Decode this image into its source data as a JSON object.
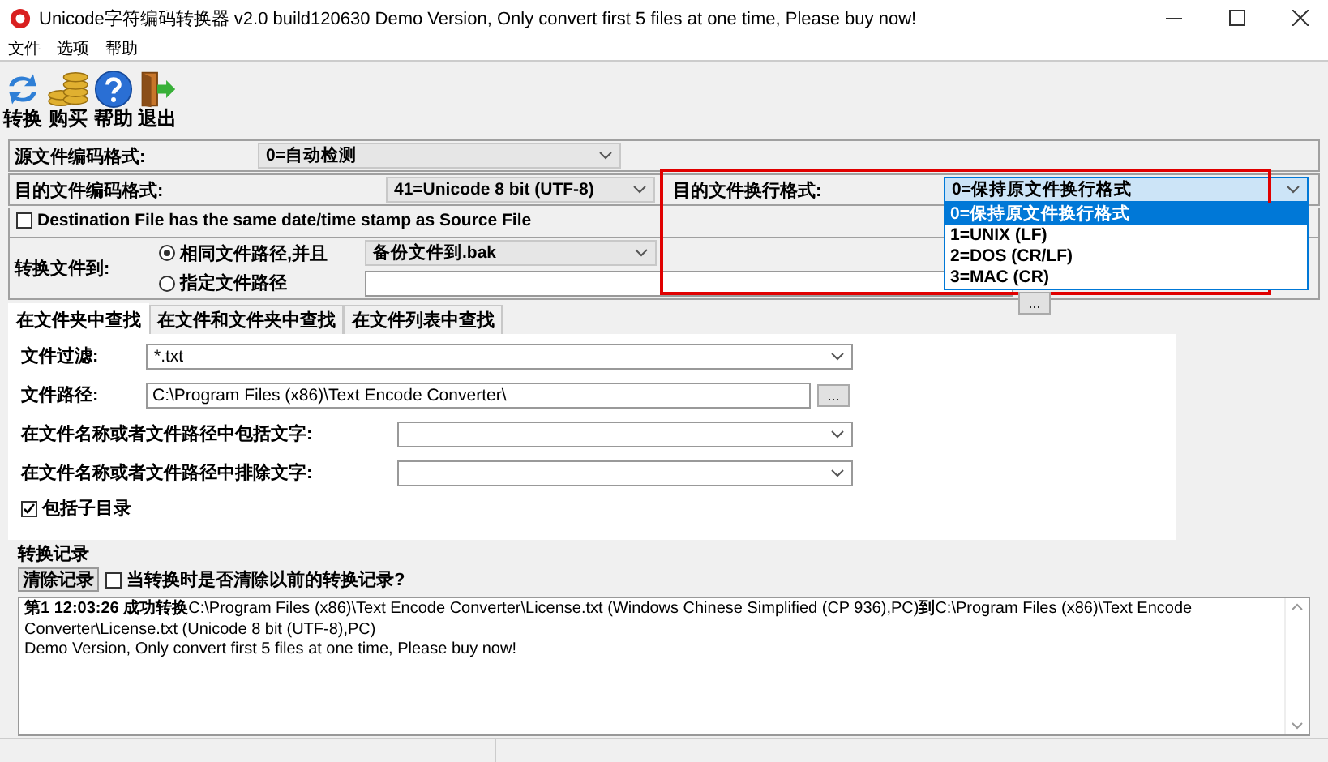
{
  "window": {
    "title": "Unicode字符编码转换器 v2.0 build120630 Demo Version, Only convert first 5 files at one time, Please buy now!"
  },
  "menu": [
    "文件",
    "选项",
    "帮助"
  ],
  "toolbar": [
    {
      "kind": "convert",
      "label": "转换"
    },
    {
      "kind": "buy",
      "label": "购买"
    },
    {
      "kind": "help",
      "label": "帮助"
    },
    {
      "kind": "exit",
      "label": "退出"
    }
  ],
  "source_encoding": {
    "label": "源文件编码格式:",
    "value": "0=自动检测"
  },
  "target_encoding": {
    "label": "目的文件编码格式:",
    "value": "41=Unicode 8 bit (UTF-8)"
  },
  "line_ending": {
    "label": "目的文件换行格式:",
    "value": "0=保持原文件换行格式",
    "expanded": true,
    "options": [
      {
        "label": "0=保持原文件换行格式",
        "selected": true
      },
      {
        "label": "1=UNIX (LF)",
        "selected": false
      },
      {
        "label": "2=DOS (CR/LF)",
        "selected": false
      },
      {
        "label": "3=MAC (CR)",
        "selected": false
      }
    ]
  },
  "same_timestamp": {
    "label": "Destination File has the same date/time stamp as Source File",
    "checked": false
  },
  "convert_to": {
    "label": "转换文件到:",
    "options": [
      {
        "label": "相同文件路径,并且",
        "selected": true
      },
      {
        "label": "指定文件路径",
        "selected": false
      }
    ],
    "backup": "备份文件到.bak",
    "browse": "..."
  },
  "tabs": [
    {
      "label": "在文件夹中查找",
      "selected": true
    },
    {
      "label": "在文件和文件夹中查找",
      "selected": false
    },
    {
      "label": "在文件列表中查找",
      "selected": false
    }
  ],
  "filter": {
    "label": "文件过滤:",
    "value": "*.txt"
  },
  "path": {
    "label": "文件路径:",
    "value": "C:\\Program Files (x86)\\Text Encode Converter\\",
    "browse": "..."
  },
  "include_text": {
    "label": "在文件名称或者文件路径中包括文字:"
  },
  "exclude_text": {
    "label": "在文件名称或者文件路径中排除文字:"
  },
  "include_subdirs": {
    "label": "包括子目录",
    "checked": true
  },
  "log": {
    "title": "转换记录",
    "clear_button": "清除记录",
    "clear_option": {
      "label": "当转换时是否清除以前的转换记录?",
      "checked": false
    },
    "lines": [
      "**第1 12:03:26 成功转换**C:\\Program Files (x86)\\Text Encode Converter\\License.txt (Windows Chinese Simplified (CP 936),PC)**到**C:\\Program Files (x86)\\Text Encode Converter\\License.txt (Unicode 8 bit (UTF-8),PC)",
      "Demo Version, Only convert first 5 files at one time, Please buy now!"
    ]
  }
}
